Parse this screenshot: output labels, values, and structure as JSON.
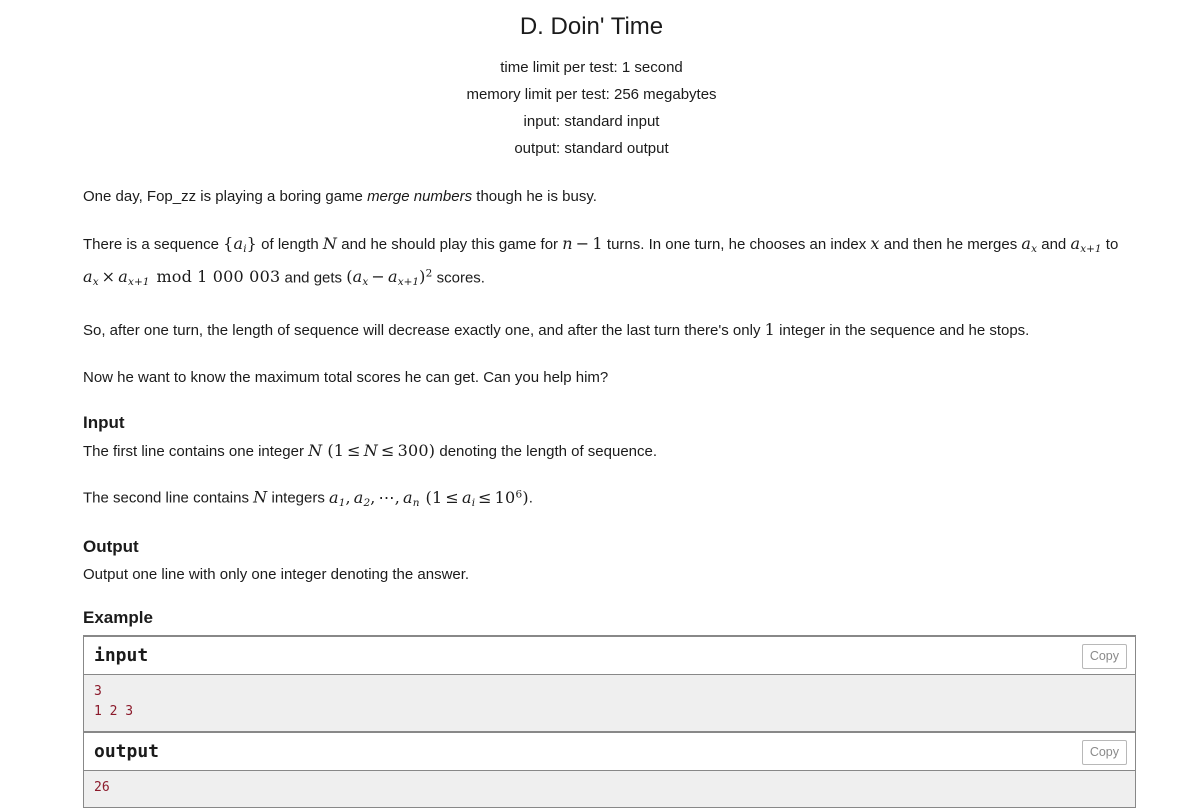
{
  "header": {
    "title": "D. Doin' Time",
    "time_limit": "time limit per test: 1 second",
    "memory_limit": "memory limit per test: 256 megabytes",
    "input_spec": "input: standard input",
    "output_spec": "output: standard output"
  },
  "statement": {
    "p1_before_em": "One day, Fop_zz is playing a boring game ",
    "p1_em": "merge numbers",
    "p1_after_em": " though he is busy.",
    "p2_s1": "There is a sequence ",
    "p2_m1_open": "{",
    "p2_m1_var": "a",
    "p2_m1_sub": "i",
    "p2_m1_close": "}",
    "p2_s2": " of length ",
    "p2_m2": "N",
    "p2_s3": " and he should play this game for ",
    "p2_m3_n": "n",
    "p2_m3_minus": "−",
    "p2_m3_one": "1",
    "p2_s4": " turns. In one turn, he chooses an index ",
    "p2_m4": "x",
    "p2_s5": " and then he merges ",
    "p2_m5_var": "a",
    "p2_m5_sub": "x",
    "p2_s6": " and ",
    "p2_m6_var": "a",
    "p2_m6_sub": "x+1",
    "p2_s7": " to ",
    "p2_m7_var1": "a",
    "p2_m7_sub1": "x",
    "p2_m7_times": "×",
    "p2_m7_var2": "a",
    "p2_m7_sub2": "x+1",
    "p2_m7_mod": "mod",
    "p2_m7_number": "1 000 003",
    "p2_s8": " and gets ",
    "p2_m8_open": "(",
    "p2_m8_var1": "a",
    "p2_m8_sub1": "x",
    "p2_m8_minus": "−",
    "p2_m8_var2": "a",
    "p2_m8_sub2": "x+1",
    "p2_m8_close": ")",
    "p2_m8_sup": "2",
    "p2_s9": " scores.",
    "p3_s1": "So, after one turn, the length of sequence will decrease exactly one, and after the last turn there's only ",
    "p3_m1": "1",
    "p3_s2": " integer in the sequence and he stops.",
    "p4": "Now he want to know the maximum total scores he can get. Can you help him?"
  },
  "input_section": {
    "heading": "Input",
    "l1_s1": "The first line contains one integer ",
    "l1_m1": "N",
    "l1_m2_open": "(",
    "l1_m2_one": "1",
    "l1_m2_le1": "≤",
    "l1_m2_var": "N",
    "l1_m2_le2": "≤",
    "l1_m2_max": "300",
    "l1_m2_close": ")",
    "l1_s2": " denoting the length of sequence.",
    "l2_s1": "The second line contains ",
    "l2_m1": "N",
    "l2_s2": " integers ",
    "l2_m2_a1": "a",
    "l2_m2_a1sub": "1",
    "l2_m2_comma1": ",",
    "l2_m2_a2": "a",
    "l2_m2_a2sub": "2",
    "l2_m2_comma2": ",",
    "l2_m2_dots": "⋯",
    "l2_m2_comma3": ",",
    "l2_m2_an": "a",
    "l2_m2_ansub": "n",
    "l2_m3_open": "(",
    "l2_m3_one": "1",
    "l2_m3_le1": "≤",
    "l2_m3_var": "a",
    "l2_m3_varsub": "i",
    "l2_m3_le2": "≤",
    "l2_m3_base": "10",
    "l2_m3_exp": "6",
    "l2_m3_close": ")",
    "l2_s3": "."
  },
  "output_section": {
    "heading": "Output",
    "text": "Output one line with only one integer denoting the answer."
  },
  "example": {
    "heading": "Example",
    "input_label": "input",
    "input_copy_label": "Copy",
    "input_data": "3\n1 2 3",
    "output_label": "output",
    "output_copy_label": "Copy",
    "output_data": "26"
  },
  "colors": {
    "text": "#1b1b1b",
    "sample_text": "#8b1a2b",
    "sample_bg": "#efefef",
    "border": "#888888",
    "copy_text": "#8a8a8a"
  }
}
